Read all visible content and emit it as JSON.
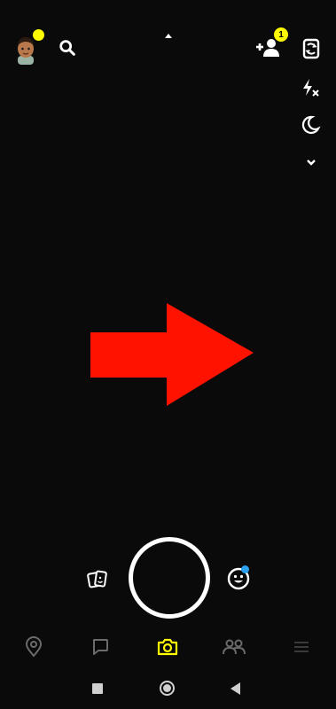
{
  "colors": {
    "background": "#0a0a0a",
    "accent_yellow": "#fffc00",
    "icon_white": "#ffffff",
    "nav_gray": "#6b6b6b",
    "arrow_red": "#ff1300",
    "lens_dot_blue": "#2ba1f0"
  },
  "top_bar": {
    "avatar_icon": "bitmoji-avatar-icon",
    "avatar_notification": "yellow-dot",
    "search_icon": "search-icon",
    "add_friend_icon": "add-friend-icon",
    "add_friend_badge": "1"
  },
  "camera_tools": [
    "flip-camera-icon",
    "flash-off-icon",
    "night-mode-icon",
    "chevron-down-icon"
  ],
  "capture_row": {
    "memories_icon": "memories-cards-icon",
    "shutter": "capture-button",
    "lenses_icon": "lenses-smiley-icon"
  },
  "bottom_nav": {
    "items": [
      "map-pin-icon",
      "chat-icon",
      "camera-icon",
      "friends-icon",
      "stories-icon"
    ],
    "active": "camera-icon"
  },
  "system_nav": [
    "recents-square-icon",
    "home-circle-icon",
    "back-triangle-icon"
  ]
}
